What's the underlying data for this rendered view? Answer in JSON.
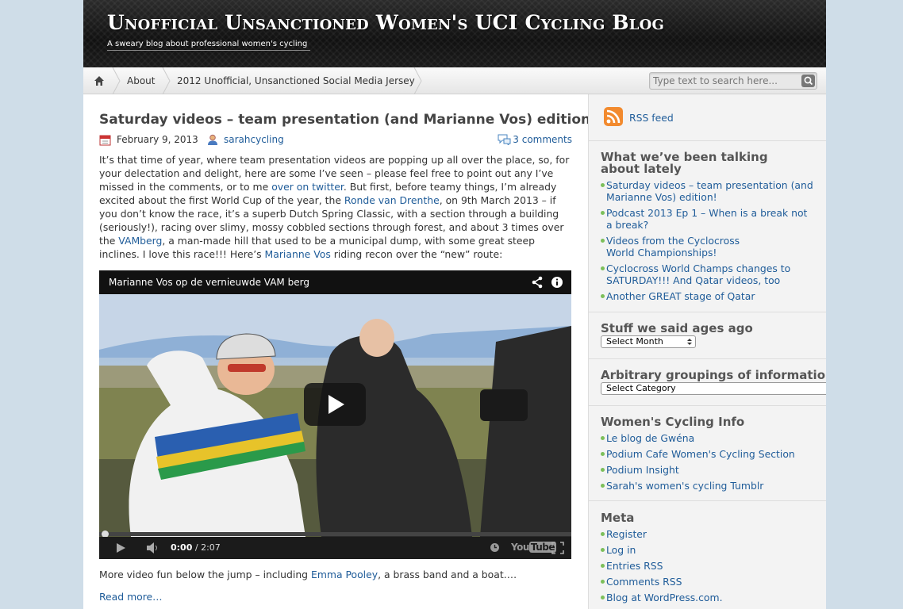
{
  "header": {
    "title": "Unofficial Unsanctioned Women's UCI Cycling Blog",
    "description": "A sweary blog about professional women's cycling"
  },
  "nav": {
    "items": [
      "About",
      "2012 Unofficial, Unsanctioned Social Media Jersey"
    ],
    "search_placeholder": "Type text to search here..."
  },
  "post": {
    "title": "Saturday videos – team presentation (and Marianne Vos) edition!",
    "date": "February 9, 2013",
    "author": "sarahcycling",
    "comments": "3 comments",
    "body": {
      "p1": "It’s that time of year, where team presentation videos are popping up all over the place, so, for your delectation and delight, here are some I’ve seen – please feel free to point out any I’ve missed in the comments, or to me ",
      "link_twitter": "over on twitter",
      "p2": ".  But first, before teamy things, I’m already excited about the first World Cup of the year, the ",
      "link_drenthe": "Ronde van Drenthe",
      "p3": ", on 9th March 2013 – if you don’t know the race, it’s a superb Dutch Spring Classic, with a section through a building (seriously!), racing over slimy, mossy cobbled sections through forest, and about 3 times over the ",
      "link_vamberg": "VAMberg",
      "p4": ", a man-made hill that used to be a municipal dump, with some great steep inclines.  I love this race!!!  Here’s ",
      "link_vos": "Marianne Vos",
      "p5": " riding recon over the “new” route:"
    },
    "video": {
      "title": "Marianne Vos op de vernieuwde VAM berg",
      "time_current": "0:00",
      "time_total": "/ 2:07",
      "progress": 0
    },
    "more_text_before": "More video fun below the jump – including ",
    "more_link": "Emma Pooley",
    "more_text_after": ", a brass band and a boat….",
    "read_more": "Read more…"
  },
  "sidebar": {
    "rss": "RSS feed",
    "recent": {
      "title": "What we’ve been talking about lately",
      "items": [
        "Saturday videos – team presentation (and Marianne Vos) edition!",
        "Podcast 2013 Ep 1 – When is a break not a break?",
        "Videos from the Cyclocross World Championships!",
        "Cyclocross World Champs changes to SATURDAY!!! And Qatar videos, too",
        "Another GREAT stage of Qatar"
      ]
    },
    "archives": {
      "title": "Stuff we said ages ago",
      "select": "Select Month"
    },
    "categories": {
      "title": "Arbitrary groupings of information",
      "select": "Select Category"
    },
    "links": {
      "title": "Women's Cycling Info",
      "items": [
        "Le blog de Gwéna",
        "Podium Cafe Women's Cycling Section",
        "Podium Insight",
        "Sarah's women's cycling Tumblr"
      ]
    },
    "meta": {
      "title": "Meta",
      "items": [
        "Register",
        "Log in",
        "Entries RSS",
        "Comments RSS",
        "Blog at WordPress.com."
      ]
    }
  },
  "colors": {
    "link": "#1f5c99",
    "bullet": "#7cbf5a",
    "header_bg": "#1a1a1a",
    "page_bg": "#cfdde8"
  }
}
